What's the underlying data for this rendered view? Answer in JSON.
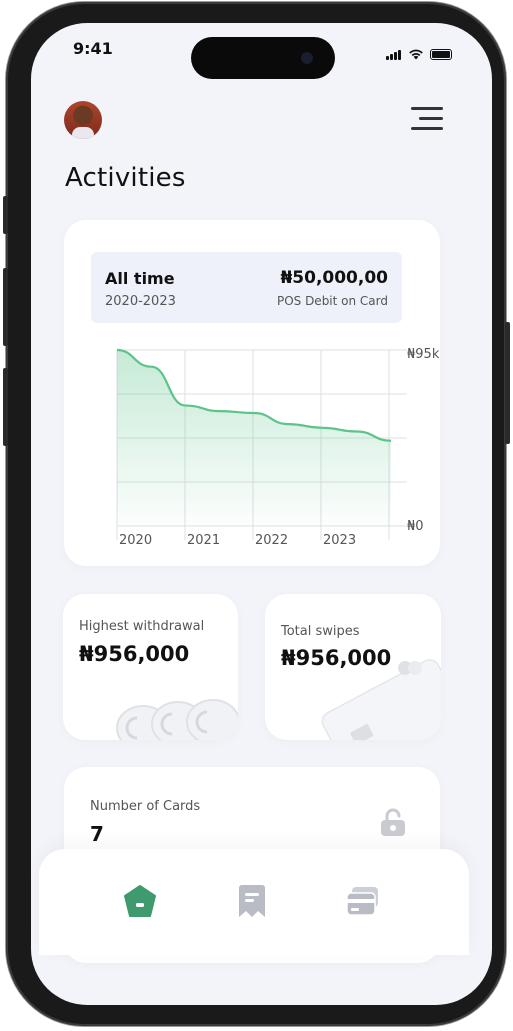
{
  "status_bar": {
    "time": "9:41"
  },
  "header": {
    "title": "Activities",
    "avatar_icon": "user-avatar",
    "menu_icon": "hamburger-menu-icon"
  },
  "summary": {
    "label": "All time",
    "range": "2020-2023",
    "amount": "₦50,000,00",
    "description": "POS Debit on Card"
  },
  "chart_data": {
    "type": "area",
    "x_ticks": [
      "2020",
      "2021",
      "2022",
      "2023"
    ],
    "y_ticks": [
      "₦95k",
      "₦0"
    ],
    "ylim": [
      0,
      95000
    ],
    "grid": true,
    "color": "#5cc48a",
    "series": [
      {
        "x": [
          2020.0,
          2020.5,
          2021.0,
          2021.5,
          2022.0,
          2022.5,
          2023.0,
          2023.5,
          2024.0
        ],
        "values": [
          95000,
          86000,
          65000,
          62000,
          61000,
          55000,
          53000,
          51000,
          46000
        ]
      }
    ]
  },
  "stats": [
    {
      "label": "Highest withdrawal",
      "value": "₦956,000"
    },
    {
      "label": "Total swipes",
      "value": "₦956,000"
    }
  ],
  "cards_count": {
    "label": "Number of Cards",
    "value": "7"
  },
  "nav": [
    {
      "icon": "home-icon",
      "active": true
    },
    {
      "icon": "receipt-icon",
      "active": false
    },
    {
      "icon": "cards-icon",
      "active": false
    }
  ],
  "colors": {
    "accent": "#3f9a6e",
    "chart": "#5cc48a",
    "background": "#f2f4fa"
  }
}
